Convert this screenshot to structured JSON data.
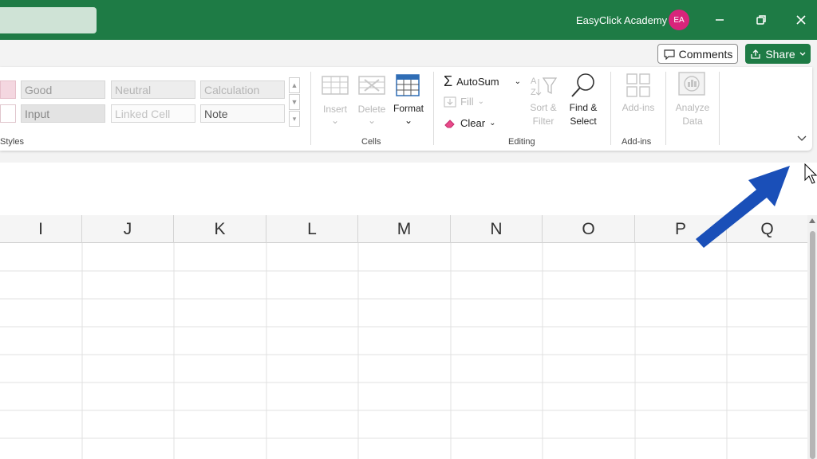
{
  "titlebar": {
    "user_name": "EasyClick Academy",
    "avatar_initials": "EA",
    "accent_color": "#1e7b45",
    "avatar_color": "#d8247b",
    "buttons": [
      "minimize-icon",
      "restore-icon",
      "close-icon"
    ]
  },
  "ribbon_top": {
    "comments_label": "Comments",
    "share_label": "Share"
  },
  "styles": {
    "cells": [
      {
        "label": "Good"
      },
      {
        "label": "Neutral"
      },
      {
        "label": "Calculation"
      },
      {
        "label": "Input"
      },
      {
        "label": "Linked Cell"
      },
      {
        "label": "Note"
      }
    ],
    "group_label": "Styles"
  },
  "cells_group": {
    "insert_line1": "Insert",
    "delete_line1": "Delete",
    "format_label": "Format",
    "group_label": "Cells"
  },
  "editing_group": {
    "autosum_label": "AutoSum",
    "fill_label": "Fill",
    "clear_label": "Clear",
    "sort_line1": "Sort &",
    "sort_line2": "Filter",
    "find_line1": "Find &",
    "find_line2": "Select",
    "group_label": "Editing"
  },
  "addins_group": {
    "addins_label": "Add-ins",
    "group_label": "Add-ins"
  },
  "analyze_group": {
    "line1": "Analyze",
    "line2": "Data"
  },
  "columns": [
    "I",
    "J",
    "K",
    "L",
    "M",
    "N",
    "O",
    "P",
    "Q"
  ]
}
